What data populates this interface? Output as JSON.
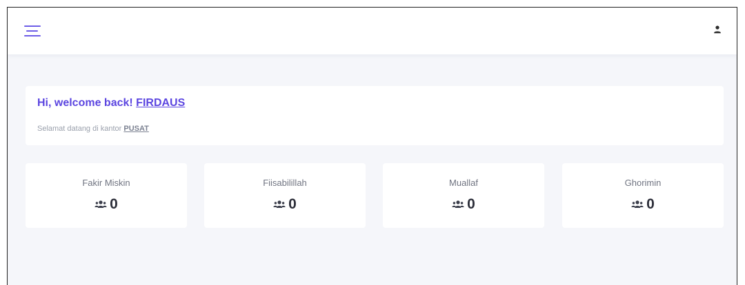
{
  "header": {
    "menu_icon": "hamburger-menu-icon",
    "user_icon": "user-icon",
    "accent_color": "#5b45e0"
  },
  "welcome": {
    "greeting": "Hi, welcome back! ",
    "user_name": "FIRDAUS",
    "subtitle": "Selamat datang di kantor ",
    "office": "PUSAT"
  },
  "stats": [
    {
      "label": "Fakir Miskin",
      "value": "0",
      "icon": "users-icon"
    },
    {
      "label": "Fiisabilillah",
      "value": "0",
      "icon": "users-icon"
    },
    {
      "label": "Muallaf",
      "value": "0",
      "icon": "users-icon"
    },
    {
      "label": "Ghorimin",
      "value": "0",
      "icon": "users-icon"
    }
  ]
}
